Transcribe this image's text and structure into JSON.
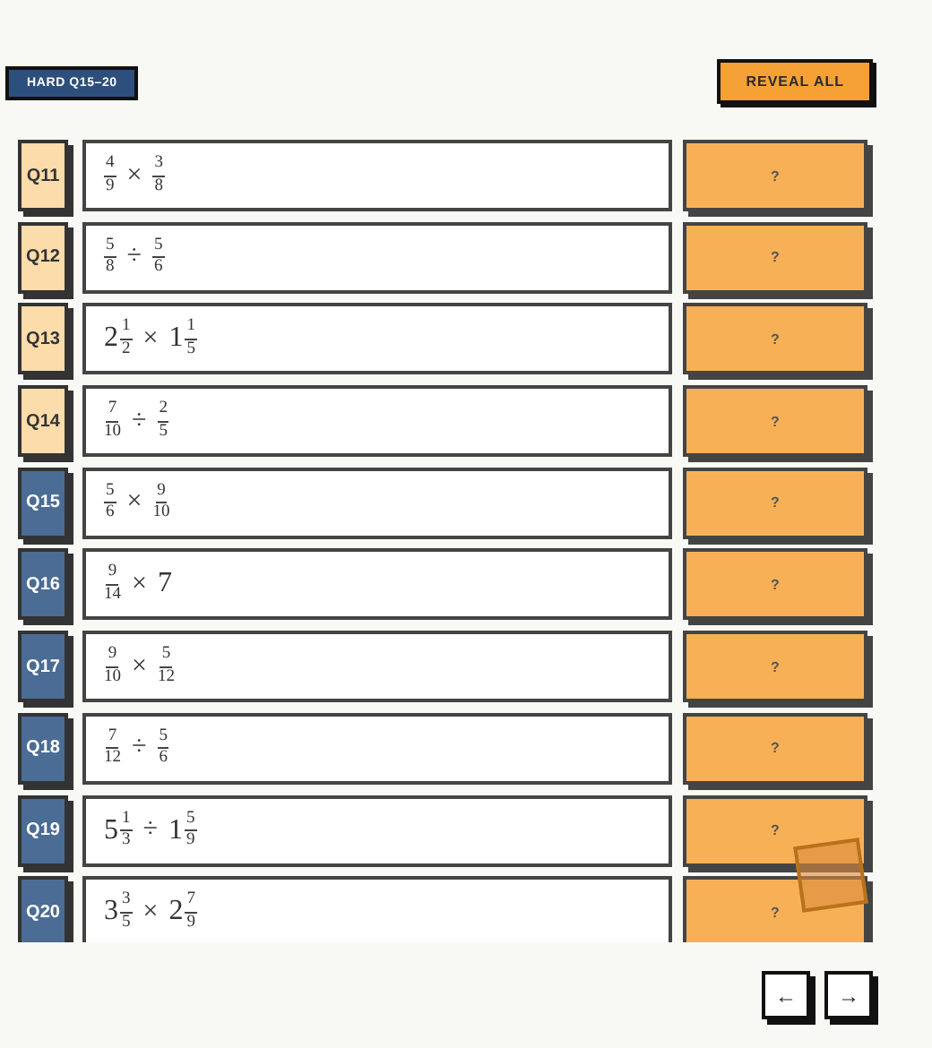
{
  "badge": "HARD Q15–20",
  "reveal_button": "REVEAL ALL",
  "questions": [
    {
      "label": "Q11",
      "kind": "standard",
      "answer": "?",
      "terms": [
        {
          "kind": "fraction",
          "num": "4",
          "den": "9"
        },
        {
          "kind": "op",
          "text": "×"
        },
        {
          "kind": "fraction",
          "num": "3",
          "den": "8"
        }
      ]
    },
    {
      "label": "Q12",
      "kind": "standard",
      "answer": "?",
      "terms": [
        {
          "kind": "fraction",
          "num": "5",
          "den": "8"
        },
        {
          "kind": "op",
          "text": "÷"
        },
        {
          "kind": "fraction",
          "num": "5",
          "den": "6"
        }
      ]
    },
    {
      "label": "Q13",
      "kind": "standard",
      "answer": "?",
      "terms": [
        {
          "kind": "mixed",
          "whole": "2",
          "num": "1",
          "den": "2"
        },
        {
          "kind": "op",
          "text": "×"
        },
        {
          "kind": "mixed",
          "whole": "1",
          "num": "1",
          "den": "5"
        }
      ]
    },
    {
      "label": "Q14",
      "kind": "standard",
      "answer": "?",
      "terms": [
        {
          "kind": "fraction",
          "num": "7",
          "den": "10"
        },
        {
          "kind": "op",
          "text": "÷"
        },
        {
          "kind": "fraction",
          "num": "2",
          "den": "5"
        }
      ]
    },
    {
      "label": "Q15",
      "kind": "hard",
      "answer": "?",
      "terms": [
        {
          "kind": "fraction",
          "num": "5",
          "den": "6"
        },
        {
          "kind": "op",
          "text": "×"
        },
        {
          "kind": "fraction",
          "num": "9",
          "den": "10"
        }
      ]
    },
    {
      "label": "Q16",
      "kind": "hard",
      "answer": "?",
      "terms": [
        {
          "kind": "fraction",
          "num": "9",
          "den": "14"
        },
        {
          "kind": "op",
          "text": "×"
        },
        {
          "kind": "whole",
          "whole": "7"
        }
      ]
    },
    {
      "label": "Q17",
      "kind": "hard",
      "answer": "?",
      "terms": [
        {
          "kind": "fraction",
          "num": "9",
          "den": "10"
        },
        {
          "kind": "op",
          "text": "×"
        },
        {
          "kind": "fraction",
          "num": "5",
          "den": "12"
        }
      ]
    },
    {
      "label": "Q18",
      "kind": "hard",
      "answer": "?",
      "terms": [
        {
          "kind": "fraction",
          "num": "7",
          "den": "12"
        },
        {
          "kind": "op",
          "text": "÷"
        },
        {
          "kind": "fraction",
          "num": "5",
          "den": "6"
        }
      ]
    },
    {
      "label": "Q19",
      "kind": "hard",
      "answer": "?",
      "terms": [
        {
          "kind": "mixed",
          "whole": "5",
          "num": "1",
          "den": "3"
        },
        {
          "kind": "op",
          "text": "÷"
        },
        {
          "kind": "mixed",
          "whole": "1",
          "num": "5",
          "den": "9"
        }
      ]
    },
    {
      "label": "Q20",
      "kind": "hard",
      "answer": "?",
      "terms": [
        {
          "kind": "mixed",
          "whole": "3",
          "num": "3",
          "den": "5"
        },
        {
          "kind": "op",
          "text": "×"
        },
        {
          "kind": "mixed",
          "whole": "2",
          "num": "7",
          "den": "9"
        }
      ]
    }
  ],
  "nav": {
    "prev": "←",
    "next": "→"
  }
}
